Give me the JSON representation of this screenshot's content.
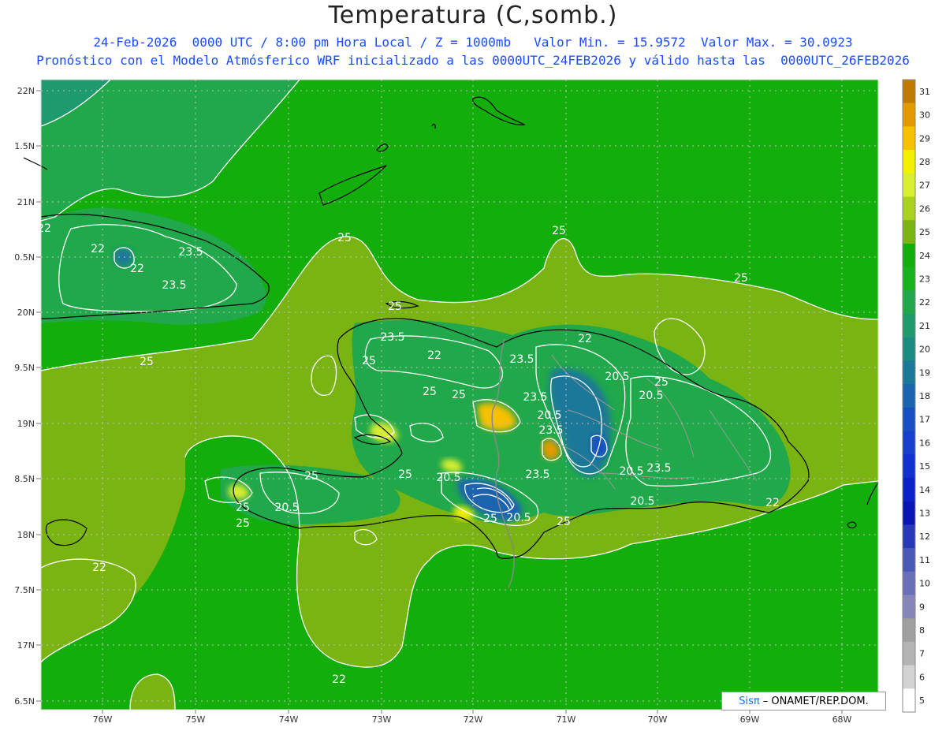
{
  "title": "Temperatura (C,somb.)",
  "subtitle_1": "24-Feb-2026  0000 UTC / 8:00 pm Hora Local / Z = 1000mb   Valor Min. = 15.9572  Valor Max. = 30.0923",
  "subtitle_2": "Pronóstico con el Modelo Atmósferico WRF inicializado a las 0000UTC_24FEB2026 y válido hasta las  0000UTC_26FEB2026",
  "credit": {
    "brand": "Sisπ",
    "text": "– ONAMET/REP.DOM."
  },
  "lat_ticks": [
    "22N",
    "1.5N",
    "21N",
    "0.5N",
    "20N",
    "9.5N",
    "19N",
    "8.5N",
    "18N",
    "7.5N",
    "17N",
    "6.5N"
  ],
  "lon_ticks": [
    "76W",
    "75W",
    "74W",
    "73W",
    "72W",
    "71W",
    "70W",
    "69W",
    "68W"
  ],
  "colorbar_labels": [
    "31",
    "30",
    "29",
    "28",
    "27",
    "26",
    "25",
    "24",
    "23",
    "22",
    "21",
    "20",
    "19",
    "18",
    "17",
    "16",
    "15",
    "14",
    "13",
    "12",
    "11",
    "10",
    "9",
    "8",
    "7",
    "6",
    "5"
  ],
  "colorbar_colors": [
    "#c07a00",
    "#e39a00",
    "#f7c000",
    "#f5f000",
    "#d8ee30",
    "#a8d21e",
    "#7ab412",
    "#13ad0c",
    "#19b21c",
    "#20a84a",
    "#1e9a6e",
    "#1a8c82",
    "#1a7898",
    "#1a64b0",
    "#1850c4",
    "#1640cc",
    "#1030d0",
    "#0a22c8",
    "#0a16b4",
    "#2838b8",
    "#4a58b8",
    "#6a70b8",
    "#8886b8",
    "#a0a0a0",
    "#b4b4b4",
    "#d2d2d2",
    "#ffffff"
  ],
  "contour_labels": [
    "25",
    "25",
    "25",
    "25",
    "25",
    "25",
    "25",
    "25",
    "25",
    "25",
    "25",
    "25",
    "25",
    "25",
    "25",
    "22",
    "22",
    "22",
    "22",
    "22",
    "22",
    "22",
    "23.5",
    "23.5",
    "23.5",
    "23.5",
    "23.5",
    "23.5",
    "23.5",
    "23.5",
    "20.5",
    "20.5",
    "20.5",
    "20.5"
  ]
}
